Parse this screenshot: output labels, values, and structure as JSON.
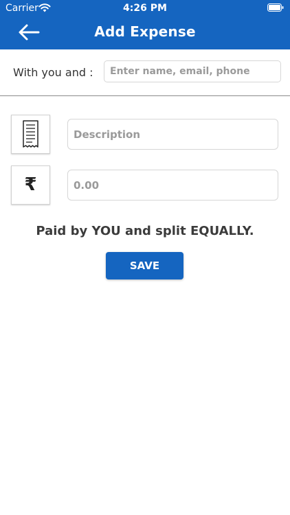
{
  "status_bar": {
    "carrier": "Carrier",
    "time": "4:26 PM",
    "icons": [
      "wifi-icon",
      "battery-icon"
    ]
  },
  "nav": {
    "title": "Add Expense",
    "back_icon": "arrow-left-icon"
  },
  "with_you": {
    "label": "With you and :",
    "placeholder": "Enter name, email, phone",
    "value": ""
  },
  "description": {
    "icon": "receipt-icon",
    "placeholder": "Description",
    "value": ""
  },
  "amount": {
    "icon": "rupee-icon",
    "currency_symbol": "₹",
    "placeholder": "0.00",
    "value": ""
  },
  "split_text": "Paid by YOU and split EQUALLY.",
  "save_label": "SAVE",
  "colors": {
    "primary": "#1565c0",
    "background": "#ffffff",
    "text": "#333333",
    "placeholder": "#9a9a9a"
  }
}
